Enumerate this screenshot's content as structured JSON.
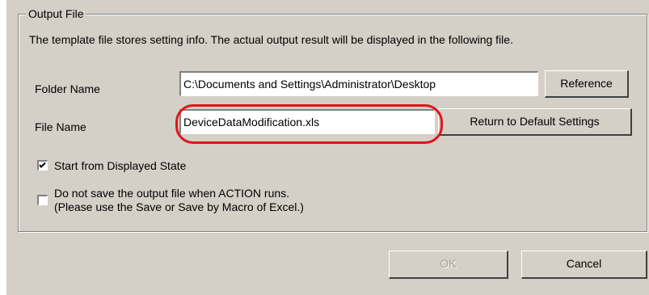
{
  "output_file": {
    "group_title": "Output File",
    "description": "The template file stores setting info. The actual output result will be displayed in the following file.",
    "folder_label": "Folder Name",
    "folder_value": "C:\\Documents and Settings\\Administrator\\Desktop",
    "reference_button": "Reference",
    "file_label": "File Name",
    "file_value": "DeviceDataModification.xls",
    "default_button": "Return to Default Settings",
    "start_checkbox": {
      "label": "Start from Displayed State",
      "checked": true
    },
    "nosave_checkbox": {
      "label_line1": "Do not save the output file when ACTION runs.",
      "label_line2": "(Please use the Save or Save by Macro of Excel.)",
      "checked": false
    }
  },
  "footer": {
    "ok_button": "OK",
    "ok_enabled": false,
    "cancel_button": "Cancel"
  },
  "colors": {
    "dialog_bg": "#d4d0c8",
    "highlight": "#e0151b"
  },
  "icons": {
    "check": "checkmark-icon"
  }
}
